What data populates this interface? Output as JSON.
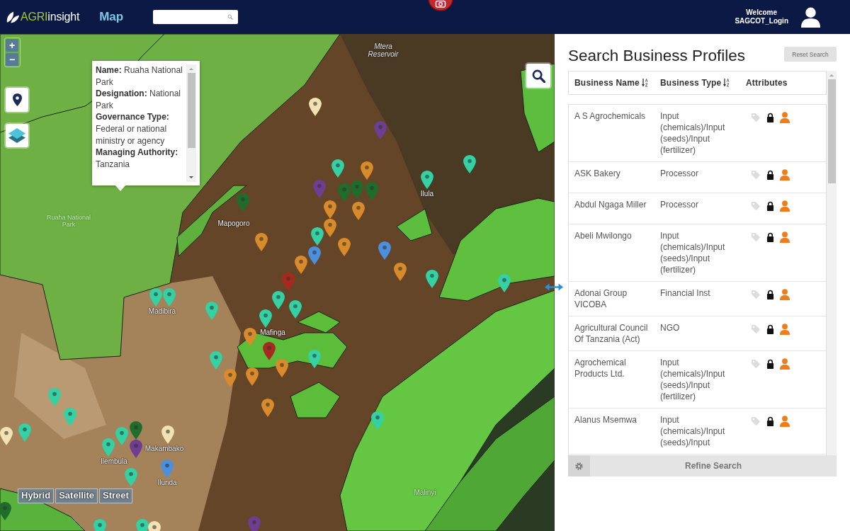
{
  "header": {
    "logo": {
      "prefix": "AGRI",
      "suffix": "insight"
    },
    "page_title": "Map",
    "user": {
      "greeting": "Welcome",
      "username": "SAGCOT_Login"
    }
  },
  "map": {
    "zoom_buttons": [
      "+",
      "−"
    ],
    "popup": {
      "fields": [
        {
          "label": "Name:",
          "value": "Ruaha National Park"
        },
        {
          "label": "Designation:",
          "value": "National Park"
        },
        {
          "label": "Governance Type:",
          "value": "Federal or national ministry or agency"
        },
        {
          "label": "Managing Authority:",
          "value": "Tanzania"
        }
      ]
    },
    "labels": [
      {
        "text": "Mtera Reservoir",
        "kind": "water"
      },
      {
        "text": "Ruaha National Park",
        "kind": "park"
      },
      {
        "text": "Mapogoro",
        "kind": "town"
      },
      {
        "text": "Ilula",
        "kind": "town"
      },
      {
        "text": "Madibira",
        "kind": "town"
      },
      {
        "text": "Mafinga",
        "kind": "town"
      },
      {
        "text": "Ilembula",
        "kind": "town"
      },
      {
        "text": "Makambako",
        "kind": "town"
      },
      {
        "text": "Ilunda",
        "kind": "town"
      },
      {
        "text": "Malinyi",
        "kind": "faint"
      }
    ],
    "markers": [
      {
        "color": "#f3e2b1"
      },
      {
        "color": "#6f3d92"
      },
      {
        "color": "#33d1a3"
      },
      {
        "color": "#d98a2a"
      },
      {
        "color": "#33d1a3"
      },
      {
        "color": "#33d1a3"
      },
      {
        "color": "#6f3d92"
      },
      {
        "color": "#1f6d2b"
      },
      {
        "color": "#1f6d2b"
      },
      {
        "color": "#1f6d2b"
      },
      {
        "color": "#d98a2a"
      },
      {
        "color": "#d98a2a"
      },
      {
        "color": "#1f6d2b"
      },
      {
        "color": "#d98a2a"
      },
      {
        "color": "#d98a2a"
      },
      {
        "color": "#33d1a3"
      },
      {
        "color": "#d98a2a"
      },
      {
        "color": "#4b90de"
      },
      {
        "color": "#d98a2a"
      },
      {
        "color": "#4b90de"
      },
      {
        "color": "#a82a1e"
      },
      {
        "color": "#d98a2a"
      },
      {
        "color": "#33d1a3"
      },
      {
        "color": "#33d1a3"
      },
      {
        "color": "#33d1a3"
      },
      {
        "color": "#33d1a3"
      },
      {
        "color": "#33d1a3"
      },
      {
        "color": "#33d1a3"
      },
      {
        "color": "#33d1a3"
      },
      {
        "color": "#33d1a3"
      },
      {
        "color": "#d98a2a"
      },
      {
        "color": "#a82a1e"
      },
      {
        "color": "#d98a2a"
      },
      {
        "color": "#33d1a3"
      },
      {
        "color": "#d98a2a"
      },
      {
        "color": "#d98a2a"
      },
      {
        "color": "#33d1a3"
      },
      {
        "color": "#d98a2a"
      },
      {
        "color": "#33d1a3"
      },
      {
        "color": "#33d1a3"
      },
      {
        "color": "#33d1a3"
      },
      {
        "color": "#f3e2b1"
      },
      {
        "color": "#33d1a3"
      },
      {
        "color": "#33d1a3"
      },
      {
        "color": "#1f6d2b"
      },
      {
        "color": "#33d1a3"
      },
      {
        "color": "#6f3d92"
      },
      {
        "color": "#f3e2b1"
      },
      {
        "color": "#4b90de"
      },
      {
        "color": "#33d1a3"
      },
      {
        "color": "#1f6d2b"
      },
      {
        "color": "#33d1a3"
      },
      {
        "color": "#33d1a3"
      },
      {
        "color": "#f3e2b1"
      },
      {
        "color": "#6f3d92"
      }
    ],
    "map_types": [
      "Hybrid",
      "Satellite",
      "Street"
    ]
  },
  "panel": {
    "title": "Search Business Profiles",
    "reset_button": "Reset Search",
    "columns": [
      {
        "label": "Business Name",
        "sortable": true
      },
      {
        "label": "Business Type",
        "sortable": true
      },
      {
        "label": "Attributes",
        "sortable": false
      }
    ],
    "rows": [
      {
        "name": "A S Agrochemicals",
        "type": "Input (chemicals)/Input (seeds)/Input (fertilizer)"
      },
      {
        "name": "ASK Bakery",
        "type": "Processor"
      },
      {
        "name": "Abdul Ngaga Miller",
        "type": "Processor"
      },
      {
        "name": "Abeli Mwilongo",
        "type": "Input (chemicals)/Input (seeds)/Input (fertilizer)"
      },
      {
        "name": "Adonai Group VICOBA",
        "type": "Financial Inst"
      },
      {
        "name": "Agricultural Council Of Tanzania (Act)",
        "type": "NGO"
      },
      {
        "name": "Agrochemical Products Ltd.",
        "type": "Input (chemicals)/Input (seeds)/Input (fertilizer)"
      },
      {
        "name": "Alanus Msemwa",
        "type": "Input (chemicals)/Input (seeds)/Input"
      }
    ],
    "refine_button": "Refine Search"
  }
}
